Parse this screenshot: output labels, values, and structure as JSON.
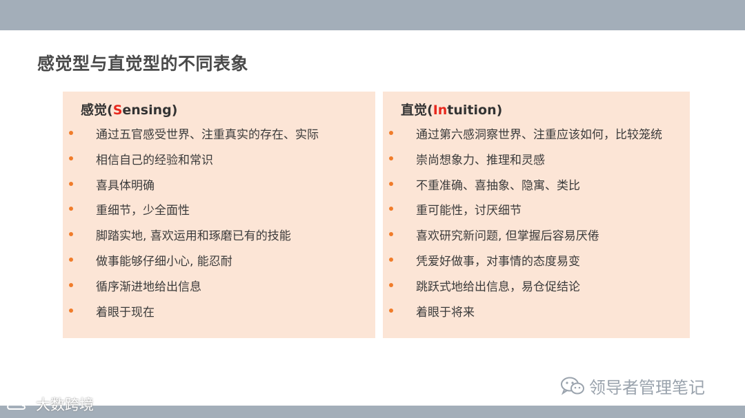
{
  "slide": {
    "title": "感觉型与直觉型的不同表象"
  },
  "left_panel": {
    "heading_prefix": "感觉(",
    "heading_highlight": "S",
    "heading_suffix": "ensing)",
    "items": [
      "通过五官感受世界、注重真实的存在、实际",
      "相信自己的经验和常识",
      "喜具体明确",
      "重细节，少全面性",
      "脚踏实地, 喜欢运用和琢磨已有的技能",
      "做事能够仔细小心, 能忍耐",
      "循序渐进地给出信息",
      "着眼于现在"
    ]
  },
  "right_panel": {
    "heading_prefix": "直觉(",
    "heading_highlight": "In",
    "heading_suffix": "tuition)",
    "items": [
      "通过第六感洞察世界、注重应该如何，比较笼统",
      "崇尚想象力、推理和灵感",
      "不重准确、喜抽象、隐寓、类比",
      "重可能性，讨厌细节",
      "喜欢研究新问题, 但掌握后容易厌倦",
      "凭爱好做事，对事情的态度易变",
      "跳跃式地给出信息，易仓促结论",
      "着眼于将来"
    ]
  },
  "watermarks": {
    "wechat_text": "领导者管理笔记",
    "wechat_icon": "wechat-icon",
    "corner_text": "大数跨境",
    "corner_icon": "cloud-logo-icon"
  },
  "colors": {
    "bar": "#a3aeb9",
    "panel": "#fce5d6",
    "bullet": "#f07c2a",
    "highlight": "#e8281e"
  }
}
